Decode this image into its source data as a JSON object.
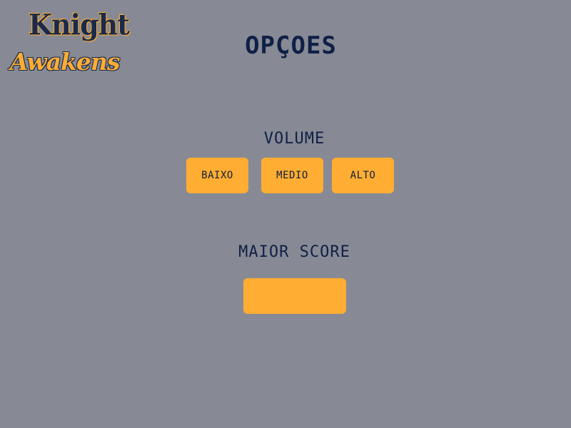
{
  "logo": {
    "line1": "Knight",
    "line2": "Awakens"
  },
  "screen": {
    "title": "OPÇOES"
  },
  "volume": {
    "label": "VOLUME",
    "options": [
      "BAIXO",
      "MEDIO",
      "ALTO"
    ]
  },
  "high_score": {
    "label": "MAIOR SCORE",
    "value": ""
  },
  "colors": {
    "background": "#878a94",
    "accent": "#ffad33",
    "text": "#0f2047"
  }
}
